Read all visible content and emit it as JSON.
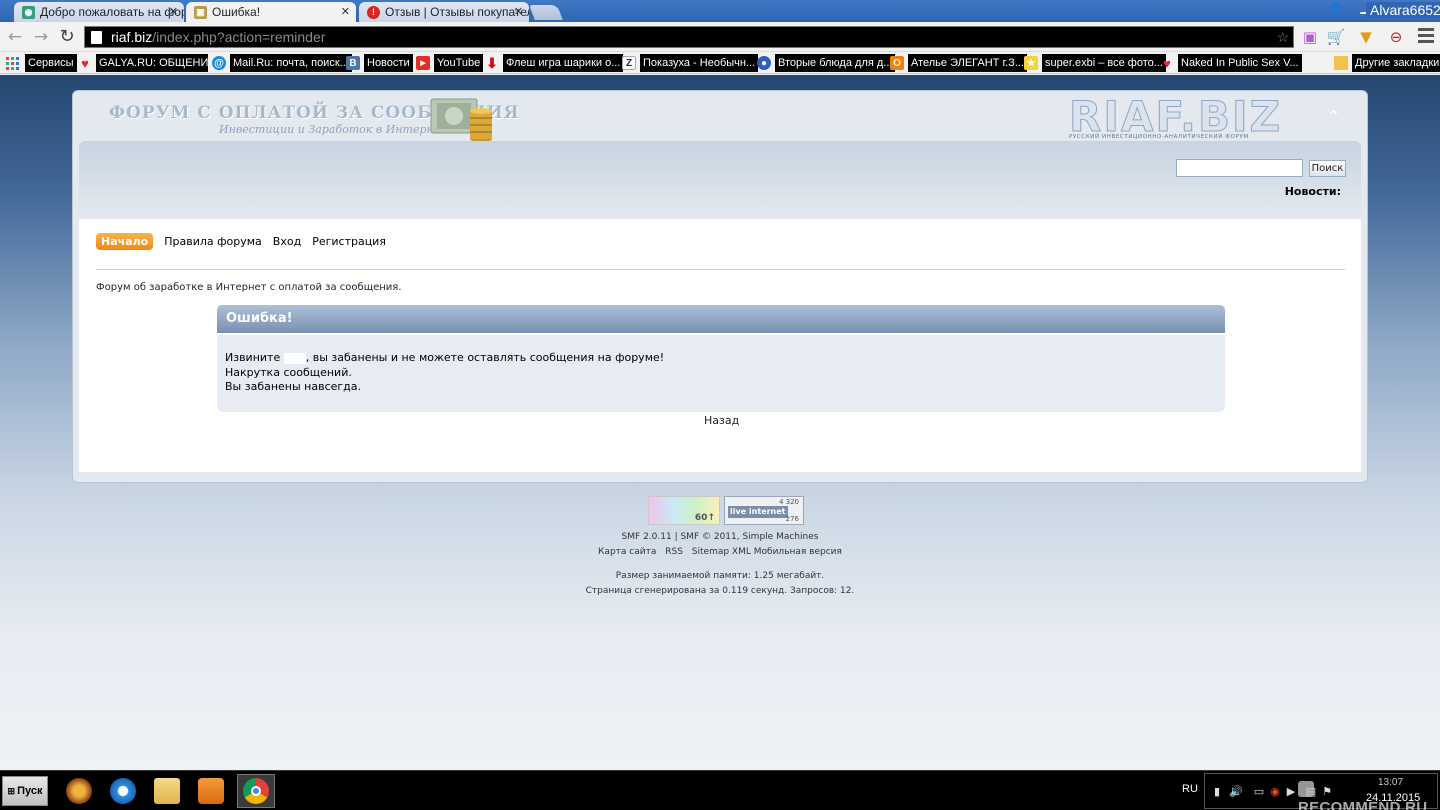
{
  "browser": {
    "tabs": [
      {
        "title": "Добро пожаловать на фор",
        "icon": "globe-icon",
        "active": false
      },
      {
        "title": "Ошибка!",
        "icon": "forum-icon",
        "active": true
      },
      {
        "title": "Отзыв | Отзывы покупател",
        "icon": "otzovik-icon",
        "active": false
      }
    ],
    "user_name": "Alvara6652",
    "url_host": "riaf.biz",
    "url_path": "/index.php?action=reminder",
    "bookmarks": [
      {
        "label": "Сервисы",
        "icon": "apps-grid-icon"
      },
      {
        "label": "GALYA.RU: ОБЩЕНИ...",
        "icon": "heart-icon"
      },
      {
        "label": "Mail.Ru: почта, поиск...",
        "icon": "mailru-icon"
      },
      {
        "label": "Новости",
        "icon": "vk-icon"
      },
      {
        "label": "YouTube",
        "icon": "youtube-icon"
      },
      {
        "label": "Флеш игра шарики о...",
        "icon": "arrow-down-icon"
      },
      {
        "label": "Показуха - Необычн...",
        "icon": "z-icon"
      },
      {
        "label": "Вторые блюда для д...",
        "icon": "cooking-icon"
      },
      {
        "label": "Ателье ЭЛЕГАНТ г.З...",
        "icon": "odnoklassniki-icon"
      },
      {
        "label": "super.exbi – все фото...",
        "icon": "star-icon"
      },
      {
        "label": "Naked In Public Sex V...",
        "icon": "heart-icon"
      },
      {
        "label": "Другие закладки",
        "icon": "folder-icon"
      }
    ]
  },
  "site": {
    "title": "Форум с оплатой за сообщения",
    "subtitle": "Инвестиции и Заработок в Интернет",
    "brand": "RIAF.BIZ",
    "brand_tagline": "русский инвестиционно-аналитический форум",
    "search_button": "Поиск",
    "news_label": "Новости:",
    "menu": [
      "Начало",
      "Правила форума",
      "Вход",
      "Регистрация"
    ],
    "forum_description": "Форум об заработке в Интернет с оплатой за сообщения."
  },
  "error": {
    "title": "Ошибка!",
    "line1_prefix": "Извините",
    "line1_suffix": ", вы забанены и не можете оставлять сообщения на форуме!",
    "line2": "Накрутка сообщений.",
    "line3": "Вы забанены навсегда.",
    "back": "Назад"
  },
  "counters": {
    "stat_value": "60↑",
    "li_logo": "live internet",
    "li_value_top": "4 320",
    "li_value_bottom": "276"
  },
  "footer": {
    "smf_version": "SMF 2.0.11",
    "smf_copyright": "SMF © 2011, Simple Machines",
    "links": [
      "Карта сайта",
      "RSS",
      "Sitemap XML",
      "Мобильная версия"
    ],
    "memory": "Размер занимаемой памяти: 1.25 мегабайт.",
    "generated": "Страница сгенерирована за 0.119 секунд. Запросов: 12."
  },
  "taskbar": {
    "start_label": "Пуск",
    "apps": [
      {
        "icon": "game-icon"
      },
      {
        "icon": "internet-explorer-icon"
      },
      {
        "icon": "file-explorer-icon"
      },
      {
        "icon": "media-player-icon"
      },
      {
        "icon": "chrome-icon",
        "active": true
      }
    ],
    "language": "RU",
    "time": "13:07",
    "date": "24.11.2015"
  },
  "watermark": "RECOMMEND.RU"
}
